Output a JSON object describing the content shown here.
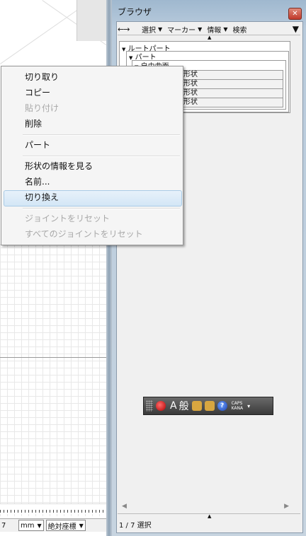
{
  "browser_panel": {
    "title": "ブラウザ",
    "close_icon": "close-icon",
    "toolbar": {
      "nav_arrows": "←→",
      "items": [
        "選択",
        "マーカー",
        "情報",
        "検索"
      ],
      "dropdown_arrow": "▼"
    },
    "tree": {
      "root": "ルートパート",
      "part": "パート",
      "surface": "自由曲面",
      "shapes": [
        "形状",
        "形状",
        "形状",
        "形状"
      ]
    },
    "status": "1 / 7 選択"
  },
  "left_status": {
    "number": "7",
    "unit": "mm",
    "coord_mode": "絶対座標"
  },
  "context_menu": {
    "items": [
      {
        "label": "切り取り",
        "enabled": true
      },
      {
        "label": "コピー",
        "enabled": true
      },
      {
        "label": "貼り付け",
        "enabled": false
      },
      {
        "label": "削除",
        "enabled": true
      },
      {
        "label": "パート",
        "enabled": true
      },
      {
        "label": "形状の情報を見る",
        "enabled": true
      },
      {
        "label": "名前...",
        "enabled": true
      },
      {
        "label": "切り換え",
        "enabled": true,
        "highlighted": true
      },
      {
        "label": "ジョイントをリセット",
        "enabled": false
      },
      {
        "label": "すべてのジョイントをリセット",
        "enabled": false
      }
    ]
  },
  "ime_toolbar": {
    "mode_char": "A",
    "general_char": "般",
    "caps": "CAPS",
    "kana": "KANA"
  }
}
